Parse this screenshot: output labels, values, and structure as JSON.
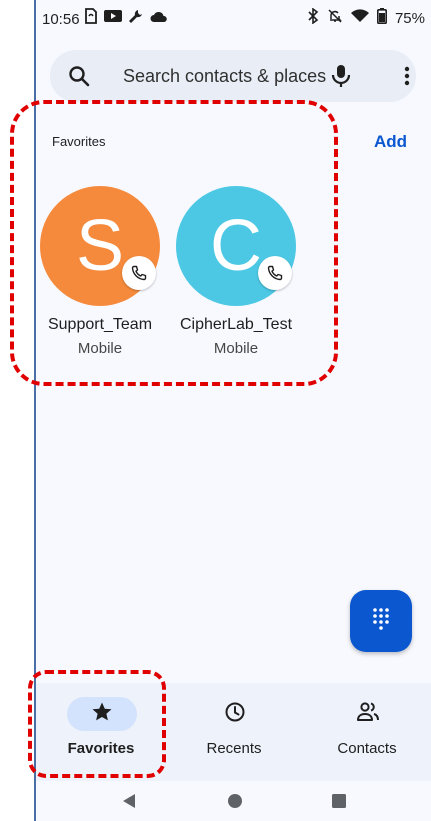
{
  "status_bar": {
    "time": "10:56",
    "battery": "75%",
    "left_icons": [
      "sim-icon",
      "youtube-icon",
      "wrench-icon",
      "cloud-icon"
    ],
    "right_icons": [
      "bluetooth-icon",
      "mute-icon",
      "wifi-icon",
      "battery-icon"
    ]
  },
  "search": {
    "placeholder": "Search contacts & places",
    "icons": [
      "search-icon",
      "microphone-icon",
      "more-vertical-icon"
    ]
  },
  "favorites_section": {
    "header": "Favorites",
    "add_label": "Add",
    "items": [
      {
        "initial": "S",
        "name": "Support_Team",
        "type": "Mobile",
        "color": "#f58a3c"
      },
      {
        "initial": "C",
        "name": "CipherLab_Test",
        "type": "Mobile",
        "color": "#4cc8e4"
      }
    ]
  },
  "fab": {
    "icon": "dialpad-icon",
    "color": "#0b57d0"
  },
  "bottom_nav": {
    "items": [
      {
        "label": "Favorites",
        "icon": "star-icon",
        "active": true
      },
      {
        "label": "Recents",
        "icon": "clock-icon",
        "active": false
      },
      {
        "label": "Contacts",
        "icon": "people-icon",
        "active": false
      }
    ]
  },
  "system_nav": {
    "icons": [
      "back-icon",
      "home-icon",
      "overview-icon"
    ]
  },
  "colors": {
    "accent": "#0b57d0",
    "highlight": "#e00000",
    "active_pill": "#d3e3fd"
  }
}
